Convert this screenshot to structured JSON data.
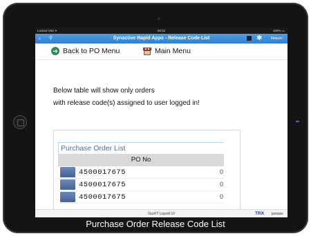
{
  "statusbar": {
    "left": "Locked SIM ✦",
    "time": "08:32",
    "right": "100% ▭"
  },
  "titlebar": {
    "title": "Synactive Rapid Apps - Release Code List",
    "return_label": "Return",
    "back_glyph": "‹",
    "search_glyph": "⚲",
    "gear_glyph": "✱"
  },
  "nav": {
    "po_menu_label": "Back to PO Menu",
    "main_menu_label": "Main Menu",
    "back_icon_glyph": "➜"
  },
  "message": {
    "line1": "Below table will show only orders",
    "line2": "with release code(s) assigned to user logged in!"
  },
  "table": {
    "caption": "Purchase Order List",
    "column_header": "PO No",
    "rows": [
      "4500017675",
      "4500017675",
      "4500017675"
    ],
    "row_trail": "0"
  },
  "footer": {
    "brand": "GuiXT Liquid UI",
    "trx": "TRX",
    "user": "juneau"
  },
  "caption": "Purchase Order Release Code List",
  "colors": {
    "titlebar": "#3b8ddc",
    "caption_text": "#3a6fb6",
    "row_selector": "#5777a6",
    "device": "#141414"
  }
}
